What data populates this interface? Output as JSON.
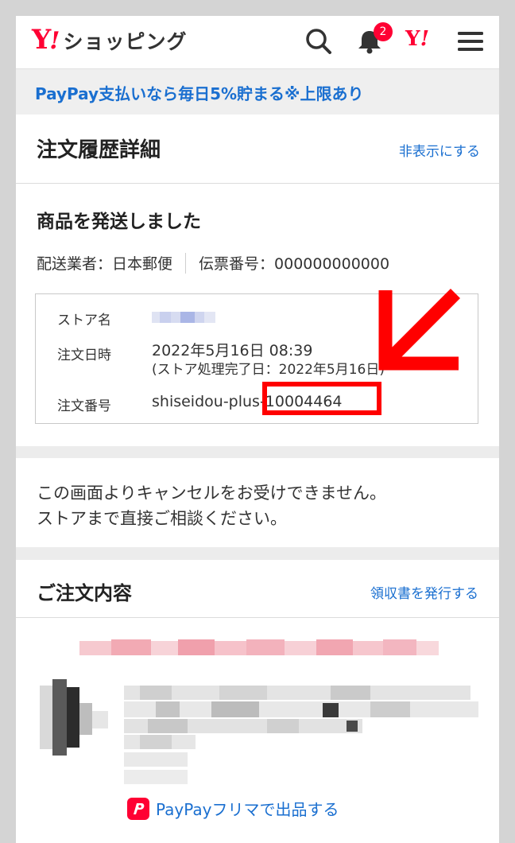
{
  "header": {
    "logo_y": "Y",
    "logo_ex": "!",
    "logo_text": "ショッピング",
    "notification_count": "2",
    "yahoo_y": "Y",
    "yahoo_ex": "!",
    "icons": [
      "search-icon",
      "bell-icon",
      "yahoo-japan-icon",
      "menu-icon"
    ]
  },
  "promo": {
    "text": "PayPay支払いなら毎日5%貯まる※上限あり"
  },
  "title_section": {
    "title": "注文履歴詳細",
    "hide_link": "非表示にする"
  },
  "shipping": {
    "status": "商品を発送しました",
    "carrier": "配送業者：日本郵便",
    "tracking": "伝票番号：000000000000",
    "labels": {
      "store": "ストア名",
      "order_date": "注文日時",
      "order_number": "注文番号"
    },
    "order_date": "2022年5月16日 08:39",
    "store_processed": "(ストア処理完了日：2022年5月16日)",
    "order_number": "shiseidou-plus-10004464"
  },
  "notice": {
    "line1": "この画面よりキャンセルをお受けできません。",
    "line2": "ストアまで直接ご相談ください。"
  },
  "contents": {
    "title": "ご注文内容",
    "receipt_link": "領収書を発行する",
    "flea_link": "PayPayフリマで出品する"
  },
  "colors": {
    "brand_red": "#ff0033",
    "link_blue": "#1a6fd0",
    "annotation_red": "#ff0000"
  }
}
